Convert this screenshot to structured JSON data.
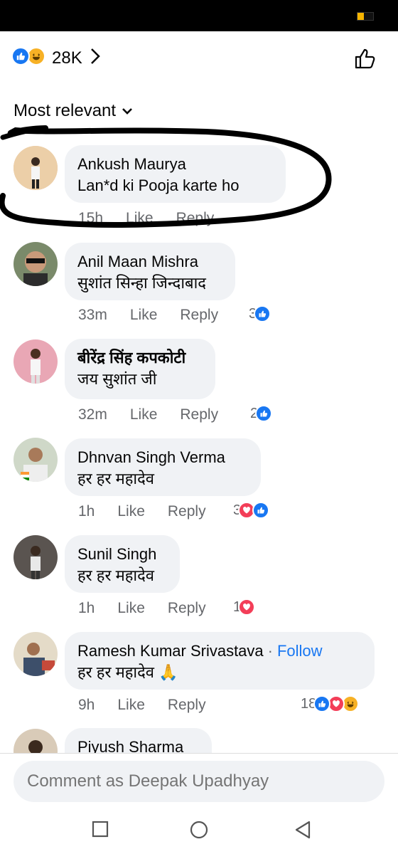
{
  "reactions": {
    "count": "28K",
    "icons": [
      "like-icon",
      "haha-icon"
    ]
  },
  "sort_label": "Most relevant",
  "comments": [
    {
      "name": "Ankush Maurya",
      "text": "Lan*d ki Pooja karte ho",
      "time": "15h",
      "like": "Like",
      "reply": "Reply",
      "reaction_count": "",
      "reaction_icons": []
    },
    {
      "name": "Anil Maan Mishra",
      "text": "सुशांत सिन्हा जिन्दाबाद",
      "time": "33m",
      "like": "Like",
      "reply": "Reply",
      "reaction_count": "3",
      "reaction_icons": [
        "like-icon"
      ]
    },
    {
      "name": "बीरेंद्र सिंह कपकोटी",
      "text": "जय सुशांत जी",
      "time": "32m",
      "like": "Like",
      "reply": "Reply",
      "reaction_count": "2",
      "reaction_icons": [
        "like-icon"
      ]
    },
    {
      "name": "Dhnvan Singh Verma",
      "text": "हर हर महादेव",
      "time": "1h",
      "like": "Like",
      "reply": "Reply",
      "reaction_count": "3",
      "reaction_icons": [
        "love-icon",
        "like-icon"
      ]
    },
    {
      "name": "Sunil Singh",
      "text": "हर हर महादेव",
      "time": "1h",
      "like": "Like",
      "reply": "Reply",
      "reaction_count": "1",
      "reaction_icons": [
        "love-icon"
      ]
    },
    {
      "name": "Ramesh Kumar Srivastava",
      "follow": "Follow",
      "text": "हर हर महादेव 🙏",
      "time": "9h",
      "like": "Like",
      "reply": "Reply",
      "reaction_count": "18",
      "reaction_icons": [
        "like-icon",
        "love-icon",
        "haha-icon"
      ]
    },
    {
      "name": "Piyush Sharma",
      "text": "",
      "time": "",
      "like": "",
      "reply": "",
      "reaction_count": "",
      "reaction_icons": []
    }
  ],
  "comment_input": {
    "placeholder": "Comment as Deepak Upadhyay"
  },
  "nav": [
    "recent-apps-icon",
    "home-icon",
    "back-icon"
  ],
  "colors": {
    "accent": "#1877f2",
    "love": "#f33e58",
    "haha": "#f7b125",
    "bubble": "#f0f2f5",
    "meta": "#65676b"
  }
}
